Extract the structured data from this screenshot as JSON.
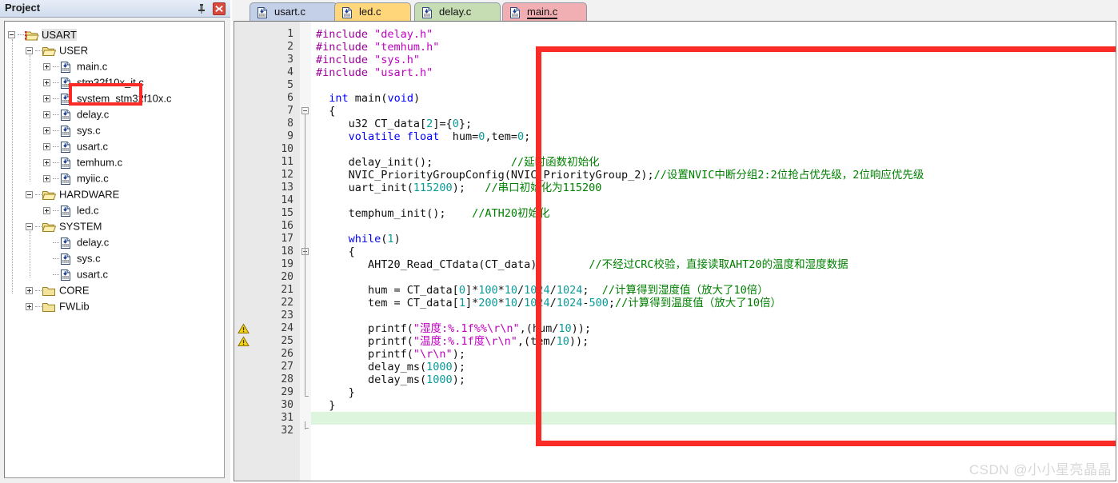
{
  "panel": {
    "title": "Project",
    "pin_icon": "pin-icon",
    "close_icon": "close-icon",
    "tree": [
      {
        "label": "USART",
        "depth": 0,
        "kind": "project",
        "expander": "minus",
        "selected": true
      },
      {
        "label": "USER",
        "depth": 1,
        "kind": "folder",
        "expander": "minus",
        "selected": false
      },
      {
        "label": "main.c",
        "depth": 2,
        "kind": "cfile",
        "expander": "plus",
        "selected": false,
        "highlighted": true
      },
      {
        "label": "stm32f10x_it.c",
        "depth": 2,
        "kind": "cfile",
        "expander": "plus",
        "selected": false
      },
      {
        "label": "system_stm32f10x.c",
        "depth": 2,
        "kind": "cfile",
        "expander": "plus",
        "selected": false
      },
      {
        "label": "delay.c",
        "depth": 2,
        "kind": "cfile",
        "expander": "plus",
        "selected": false
      },
      {
        "label": "sys.c",
        "depth": 2,
        "kind": "cfile",
        "expander": "plus",
        "selected": false
      },
      {
        "label": "usart.c",
        "depth": 2,
        "kind": "cfile",
        "expander": "plus",
        "selected": false
      },
      {
        "label": "temhum.c",
        "depth": 2,
        "kind": "cfile",
        "expander": "plus",
        "selected": false
      },
      {
        "label": "myiic.c",
        "depth": 2,
        "kind": "cfile",
        "expander": "plus",
        "selected": false
      },
      {
        "label": "HARDWARE",
        "depth": 1,
        "kind": "folder",
        "expander": "minus",
        "selected": false
      },
      {
        "label": "led.c",
        "depth": 2,
        "kind": "cfile",
        "expander": "plus",
        "selected": false
      },
      {
        "label": "SYSTEM",
        "depth": 1,
        "kind": "folder",
        "expander": "minus",
        "selected": false
      },
      {
        "label": "delay.c",
        "depth": 2,
        "kind": "cfile",
        "expander": "none",
        "selected": false
      },
      {
        "label": "sys.c",
        "depth": 2,
        "kind": "cfile",
        "expander": "none",
        "selected": false
      },
      {
        "label": "usart.c",
        "depth": 2,
        "kind": "cfile",
        "expander": "none",
        "selected": false
      },
      {
        "label": "CORE",
        "depth": 1,
        "kind": "folder-plain",
        "expander": "plus",
        "selected": false
      },
      {
        "label": "FWLib",
        "depth": 1,
        "kind": "folder-plain",
        "expander": "plus",
        "selected": false
      }
    ]
  },
  "editor": {
    "tabs": [
      {
        "label": "usart.c",
        "color": "#c4cfe8",
        "active": false
      },
      {
        "label": "led.c",
        "color": "#ffd77a",
        "active": false
      },
      {
        "label": "delay.c",
        "color": "#c6ddb4",
        "active": false
      },
      {
        "label": "main.c",
        "color": "#f2afb3",
        "active": true
      }
    ],
    "current_line": 31,
    "warning_lines": [
      24,
      25
    ],
    "fold_lines": [
      7,
      18
    ],
    "total_lines": 32,
    "lines": [
      {
        "n": 1,
        "tokens": [
          {
            "t": "#include ",
            "c": "pre"
          },
          {
            "t": "\"delay.h\"",
            "c": "str"
          }
        ]
      },
      {
        "n": 2,
        "tokens": [
          {
            "t": "#include ",
            "c": "pre"
          },
          {
            "t": "\"temhum.h\"",
            "c": "str"
          }
        ]
      },
      {
        "n": 3,
        "tokens": [
          {
            "t": "#include ",
            "c": "pre"
          },
          {
            "t": "\"sys.h\"",
            "c": "str"
          }
        ]
      },
      {
        "n": 4,
        "tokens": [
          {
            "t": "#include ",
            "c": "pre"
          },
          {
            "t": "\"usart.h\"",
            "c": "str"
          }
        ]
      },
      {
        "n": 5,
        "tokens": []
      },
      {
        "n": 6,
        "tokens": [
          {
            "t": "  ",
            "c": ""
          },
          {
            "t": "int",
            "c": "kw"
          },
          {
            "t": " main(",
            "c": ""
          },
          {
            "t": "void",
            "c": "kw"
          },
          {
            "t": ")",
            "c": ""
          }
        ]
      },
      {
        "n": 7,
        "tokens": [
          {
            "t": "  {",
            "c": ""
          }
        ]
      },
      {
        "n": 8,
        "tokens": [
          {
            "t": "     u32 CT_data[",
            "c": ""
          },
          {
            "t": "2",
            "c": "num"
          },
          {
            "t": "]={",
            "c": ""
          },
          {
            "t": "0",
            "c": "num"
          },
          {
            "t": "};",
            "c": ""
          }
        ]
      },
      {
        "n": 9,
        "tokens": [
          {
            "t": "     ",
            "c": ""
          },
          {
            "t": "volatile float",
            "c": "kw"
          },
          {
            "t": "  hum=",
            "c": ""
          },
          {
            "t": "0",
            "c": "num"
          },
          {
            "t": ",tem=",
            "c": ""
          },
          {
            "t": "0",
            "c": "num"
          },
          {
            "t": ";",
            "c": ""
          }
        ]
      },
      {
        "n": 10,
        "tokens": []
      },
      {
        "n": 11,
        "tokens": [
          {
            "t": "     delay_init();            ",
            "c": ""
          },
          {
            "t": "//延时函数初始化",
            "c": "cmt"
          }
        ]
      },
      {
        "n": 12,
        "tokens": [
          {
            "t": "     NVIC_PriorityGroupConfig(NVIC_PriorityGroup_2);",
            "c": ""
          },
          {
            "t": "//设置NVIC中断分组2:2位抢占优先级，2位响应优先级",
            "c": "cmt"
          }
        ]
      },
      {
        "n": 13,
        "tokens": [
          {
            "t": "     uart_init(",
            "c": ""
          },
          {
            "t": "115200",
            "c": "num"
          },
          {
            "t": ");   ",
            "c": ""
          },
          {
            "t": "//串口初始化为115200",
            "c": "cmt"
          }
        ]
      },
      {
        "n": 14,
        "tokens": []
      },
      {
        "n": 15,
        "tokens": [
          {
            "t": "     temphum_init();    ",
            "c": ""
          },
          {
            "t": "//ATH20初始化",
            "c": "cmt"
          }
        ]
      },
      {
        "n": 16,
        "tokens": []
      },
      {
        "n": 17,
        "tokens": [
          {
            "t": "     ",
            "c": ""
          },
          {
            "t": "while",
            "c": "kw"
          },
          {
            "t": "(",
            "c": ""
          },
          {
            "t": "1",
            "c": "num"
          },
          {
            "t": ")",
            "c": ""
          }
        ]
      },
      {
        "n": 18,
        "tokens": [
          {
            "t": "     {",
            "c": ""
          }
        ]
      },
      {
        "n": 19,
        "tokens": [
          {
            "t": "        AHT20_Read_CTdata(CT_data);       ",
            "c": ""
          },
          {
            "t": "//不经过CRC校验，直接读取AHT20的温度和湿度数据",
            "c": "cmt"
          }
        ]
      },
      {
        "n": 20,
        "tokens": []
      },
      {
        "n": 21,
        "tokens": [
          {
            "t": "        hum = CT_data[",
            "c": ""
          },
          {
            "t": "0",
            "c": "num"
          },
          {
            "t": "]*",
            "c": ""
          },
          {
            "t": "100",
            "c": "num"
          },
          {
            "t": "*",
            "c": ""
          },
          {
            "t": "10",
            "c": "num"
          },
          {
            "t": "/",
            "c": ""
          },
          {
            "t": "1024",
            "c": "num"
          },
          {
            "t": "/",
            "c": ""
          },
          {
            "t": "1024",
            "c": "num"
          },
          {
            "t": ";  ",
            "c": ""
          },
          {
            "t": "//计算得到湿度值（放大了10倍）",
            "c": "cmt"
          }
        ]
      },
      {
        "n": 22,
        "tokens": [
          {
            "t": "        tem = CT_data[",
            "c": ""
          },
          {
            "t": "1",
            "c": "num"
          },
          {
            "t": "]*",
            "c": ""
          },
          {
            "t": "200",
            "c": "num"
          },
          {
            "t": "*",
            "c": ""
          },
          {
            "t": "10",
            "c": "num"
          },
          {
            "t": "/",
            "c": ""
          },
          {
            "t": "1024",
            "c": "num"
          },
          {
            "t": "/",
            "c": ""
          },
          {
            "t": "1024",
            "c": "num"
          },
          {
            "t": "-",
            "c": ""
          },
          {
            "t": "500",
            "c": "num"
          },
          {
            "t": ";",
            "c": ""
          },
          {
            "t": "//计算得到温度值（放大了10倍）",
            "c": "cmt"
          }
        ]
      },
      {
        "n": 23,
        "tokens": []
      },
      {
        "n": 24,
        "tokens": [
          {
            "t": "        printf(",
            "c": ""
          },
          {
            "t": "\"湿度:%.1f%%\\r\\n\"",
            "c": "str"
          },
          {
            "t": ",(hum/",
            "c": ""
          },
          {
            "t": "10",
            "c": "num"
          },
          {
            "t": "));",
            "c": ""
          }
        ]
      },
      {
        "n": 25,
        "tokens": [
          {
            "t": "        printf(",
            "c": ""
          },
          {
            "t": "\"温度:%.1f度\\r\\n\"",
            "c": "str"
          },
          {
            "t": ",(tem/",
            "c": ""
          },
          {
            "t": "10",
            "c": "num"
          },
          {
            "t": "));",
            "c": ""
          }
        ]
      },
      {
        "n": 26,
        "tokens": [
          {
            "t": "        printf(",
            "c": ""
          },
          {
            "t": "\"\\r\\n\"",
            "c": "str"
          },
          {
            "t": ");",
            "c": ""
          }
        ]
      },
      {
        "n": 27,
        "tokens": [
          {
            "t": "        delay_ms(",
            "c": ""
          },
          {
            "t": "1000",
            "c": "num"
          },
          {
            "t": ");",
            "c": ""
          }
        ]
      },
      {
        "n": 28,
        "tokens": [
          {
            "t": "        delay_ms(",
            "c": ""
          },
          {
            "t": "1000",
            "c": "num"
          },
          {
            "t": ");",
            "c": ""
          }
        ]
      },
      {
        "n": 29,
        "tokens": [
          {
            "t": "     }",
            "c": ""
          }
        ]
      },
      {
        "n": 30,
        "tokens": [
          {
            "t": "  }",
            "c": ""
          }
        ]
      },
      {
        "n": 31,
        "tokens": []
      },
      {
        "n": 32,
        "tokens": []
      }
    ]
  },
  "watermark": {
    "text": "CSDN @小小星亮晶晶"
  },
  "colors": {
    "annotation_red": "#fa2a27",
    "current_line": "#ddf5dd"
  }
}
